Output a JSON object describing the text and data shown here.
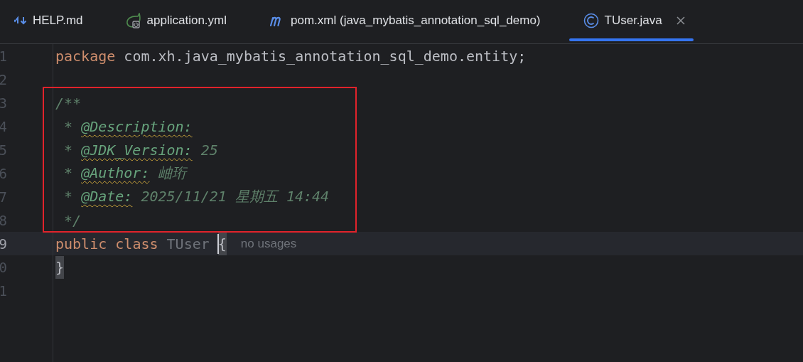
{
  "tabs": [
    {
      "label": "HELP.md",
      "kind": "markdown",
      "selected": false
    },
    {
      "label": "application.yml",
      "kind": "config",
      "selected": false
    },
    {
      "label": "pom.xml (java_mybatis_annotation_sql_demo)",
      "kind": "build",
      "selected": false
    },
    {
      "label": "TUser.java",
      "kind": "class",
      "selected": true
    }
  ],
  "editor": {
    "lines": [
      {
        "number": "1",
        "current": false,
        "boxed": false,
        "tokens": [
          {
            "kind": "keyword",
            "text": "package"
          },
          {
            "kind": "plain",
            "text": " com.xh.java_mybatis_annotation_sql_demo.entity;"
          }
        ]
      },
      {
        "number": "2",
        "current": false,
        "boxed": false
      },
      {
        "number": "3",
        "current": false,
        "boxed": true,
        "tokens": [
          {
            "kind": "comment",
            "text": "/**"
          }
        ]
      },
      {
        "number": "4",
        "current": false,
        "boxed": true,
        "tokens": [
          {
            "kind": "comment",
            "text": " * "
          },
          {
            "kind": "doctag",
            "text": "@Description:"
          }
        ]
      },
      {
        "number": "5",
        "current": false,
        "boxed": true,
        "tokens": [
          {
            "kind": "comment",
            "text": " * "
          },
          {
            "kind": "doctag",
            "text": "@JDK_Version:"
          },
          {
            "kind": "comment",
            "text": " 25"
          }
        ]
      },
      {
        "number": "6",
        "current": false,
        "boxed": true,
        "tokens": [
          {
            "kind": "comment",
            "text": " * "
          },
          {
            "kind": "doctag",
            "text": "@Author:"
          },
          {
            "kind": "comment",
            "text": " 岫珩"
          }
        ]
      },
      {
        "number": "7",
        "current": false,
        "boxed": true,
        "tokens": [
          {
            "kind": "comment",
            "text": " * "
          },
          {
            "kind": "doctag",
            "text": "@Date:"
          },
          {
            "kind": "comment",
            "text": " 2025/11/21 星期五 14:44"
          }
        ]
      },
      {
        "number": "8",
        "current": false,
        "boxed": true,
        "tokens": [
          {
            "kind": "comment",
            "text": " */"
          }
        ]
      },
      {
        "number": "9",
        "current": true,
        "boxed": false,
        "tokens": [
          {
            "kind": "keyword",
            "text": "public "
          },
          {
            "kind": "keyword",
            "text": "class "
          },
          {
            "kind": "unused",
            "text": "TUser "
          },
          {
            "kind": "brace",
            "text": "{",
            "caret": true
          }
        ],
        "hint": "no usages"
      },
      {
        "number": "0",
        "current": false,
        "boxed": false,
        "tokens": [
          {
            "kind": "brace",
            "text": "}",
            "caret": false
          }
        ]
      },
      {
        "number": "1",
        "current": false,
        "boxed": false
      }
    ]
  }
}
